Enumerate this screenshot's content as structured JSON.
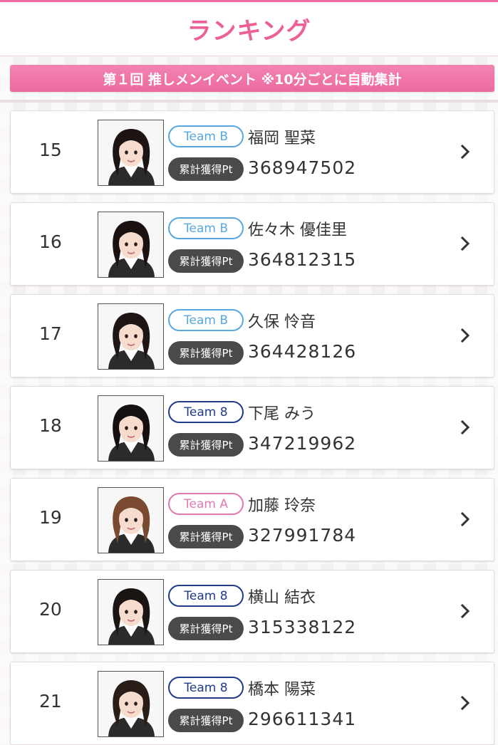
{
  "header": {
    "title": "ランキング"
  },
  "event": {
    "banner": "第１回 推しメンイベント ※10分ごとに自動集計"
  },
  "pt_label": "累計獲得Pt",
  "accent_color": "#ec5f97",
  "team_colors": {
    "Team B": "#58a8e0",
    "Team 8": "#1f3c8a",
    "Team A": "#e07ab0"
  },
  "ranking": [
    {
      "rank": "15",
      "team": "Team B",
      "name": "福岡 聖菜",
      "points": "368947502",
      "hair": "#1c1412"
    },
    {
      "rank": "16",
      "team": "Team B",
      "name": "佐々木 優佳里",
      "points": "364812315",
      "hair": "#1a1210"
    },
    {
      "rank": "17",
      "team": "Team B",
      "name": "久保 怜音",
      "points": "364428126",
      "hair": "#1d1513"
    },
    {
      "rank": "18",
      "team": "Team 8",
      "name": "下尾 みう",
      "points": "347219962",
      "hair": "#151010"
    },
    {
      "rank": "19",
      "team": "Team A",
      "name": "加藤 玲奈",
      "points": "327991784",
      "hair": "#7a4a30"
    },
    {
      "rank": "20",
      "team": "Team 8",
      "name": "横山 結衣",
      "points": "315338122",
      "hair": "#1a1412"
    },
    {
      "rank": "21",
      "team": "Team 8",
      "name": "橋本 陽菜",
      "points": "296611341",
      "hair": "#2a1d18"
    }
  ]
}
